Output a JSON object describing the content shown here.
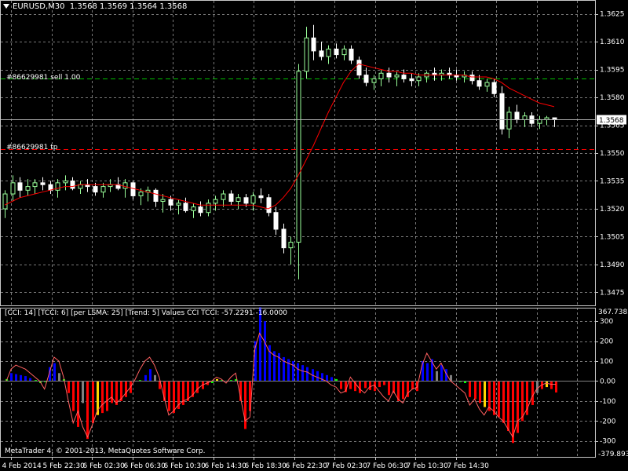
{
  "window": {
    "symbol_label": "EURUSD,M30",
    "ohlc_label": "1.3568 1.3569 1.3564 1.3568",
    "copyright": "MetaTrader 4, © 2001-2013, MetaQuotes Software Corp."
  },
  "orders": {
    "sell_label": "#86629981 sell 1.00",
    "tp_label": "#86629981 tp"
  },
  "price_axis": {
    "ticks": [
      "1.3625",
      "1.3610",
      "1.3595",
      "1.3580",
      "1.3565",
      "1.3550",
      "1.3535",
      "1.3520",
      "1.3505",
      "1.3490",
      "1.3475"
    ],
    "current_price": "1.3568"
  },
  "indicator": {
    "header": "[CCI: 14] [TCCI: 6] [per LSMA: 25] [Trend: 5] Values CCI TCCI: -57.2291 -16.0000",
    "max_label": "367.7385",
    "min_label": "-379.893",
    "ticks": [
      "300",
      "200",
      "100",
      "0.00",
      "-100",
      "-200",
      "-300"
    ]
  },
  "time_axis": {
    "ticks": [
      "4 Feb 2014",
      "5 Feb 22:30",
      "6 Feb 02:30",
      "6 Feb 06:30",
      "6 Feb 10:30",
      "6 Feb 14:30",
      "6 Feb 18:30",
      "6 Feb 22:30",
      "7 Feb 02:30",
      "7 Feb 06:30",
      "7 Feb 10:30",
      "7 Feb 14:30"
    ]
  },
  "colors": {
    "background": "#000000",
    "grid": "#c8c8c8",
    "bull_candle": "#9aff9a",
    "bear_candle": "#ffffff",
    "ma_line": "#ff0000",
    "sell_line": "#00c000",
    "tp_line": "#ff0000",
    "cci_up": "#0000ff",
    "cci_down": "#ff0000",
    "cci_neutral": "#808080",
    "cci_flat": "#00ff00",
    "cci_cross": "#ffd700"
  },
  "chart_data": {
    "type": "candlestick",
    "symbol": "EURUSD",
    "timeframe": "M30",
    "ylim": [
      1.3468,
      1.3632
    ],
    "sell_order_price": 1.359,
    "tp_price": 1.3552,
    "current_price": 1.3568,
    "candles": [
      [
        1.352,
        1.353,
        1.3515,
        1.3528
      ],
      [
        1.3528,
        1.3538,
        1.3524,
        1.3534
      ],
      [
        1.3534,
        1.3537,
        1.3526,
        1.353
      ],
      [
        1.353,
        1.3536,
        1.3527,
        1.3532
      ],
      [
        1.3532,
        1.3536,
        1.3528,
        1.3534
      ],
      [
        1.3534,
        1.3537,
        1.353,
        1.3533
      ],
      [
        1.3533,
        1.3535,
        1.3528,
        1.353
      ],
      [
        1.353,
        1.3536,
        1.3526,
        1.3534
      ],
      [
        1.3534,
        1.3538,
        1.353,
        1.3535
      ],
      [
        1.3535,
        1.3537,
        1.353,
        1.3531
      ],
      [
        1.3531,
        1.3535,
        1.3528,
        1.3533
      ],
      [
        1.3533,
        1.3536,
        1.3529,
        1.3532
      ],
      [
        1.3532,
        1.3534,
        1.3527,
        1.3529
      ],
      [
        1.3529,
        1.3534,
        1.3526,
        1.3532
      ],
      [
        1.3532,
        1.3536,
        1.3529,
        1.3533
      ],
      [
        1.3533,
        1.3537,
        1.353,
        1.3531
      ],
      [
        1.3531,
        1.3536,
        1.3526,
        1.3534
      ],
      [
        1.3534,
        1.3535,
        1.3525,
        1.3527
      ],
      [
        1.3527,
        1.3531,
        1.3522,
        1.3529
      ],
      [
        1.3529,
        1.3532,
        1.3524,
        1.353
      ],
      [
        1.353,
        1.3531,
        1.3521,
        1.3524
      ],
      [
        1.3524,
        1.3528,
        1.3518,
        1.3525
      ],
      [
        1.3525,
        1.3527,
        1.3519,
        1.3522
      ],
      [
        1.3522,
        1.3525,
        1.3517,
        1.3523
      ],
      [
        1.3523,
        1.3526,
        1.3518,
        1.3519
      ],
      [
        1.3519,
        1.3523,
        1.3515,
        1.3521
      ],
      [
        1.3521,
        1.3524,
        1.3516,
        1.3518
      ],
      [
        1.3518,
        1.3525,
        1.3516,
        1.3523
      ],
      [
        1.3523,
        1.3527,
        1.3519,
        1.3525
      ],
      [
        1.3525,
        1.353,
        1.3521,
        1.3528
      ],
      [
        1.3528,
        1.353,
        1.3522,
        1.3524
      ],
      [
        1.3524,
        1.3528,
        1.352,
        1.3526
      ],
      [
        1.3526,
        1.3528,
        1.3521,
        1.3523
      ],
      [
        1.3523,
        1.3529,
        1.3519,
        1.3527
      ],
      [
        1.3527,
        1.3531,
        1.3523,
        1.3526
      ],
      [
        1.3526,
        1.3528,
        1.3516,
        1.3518
      ],
      [
        1.3518,
        1.3521,
        1.3506,
        1.3509
      ],
      [
        1.3509,
        1.3512,
        1.3496,
        1.3499
      ],
      [
        1.3499,
        1.3505,
        1.349,
        1.3502
      ],
      [
        1.3502,
        1.3598,
        1.3482,
        1.3594
      ],
      [
        1.3594,
        1.3618,
        1.359,
        1.3612
      ],
      [
        1.3612,
        1.3619,
        1.36,
        1.3605
      ],
      [
        1.3605,
        1.361,
        1.36,
        1.3602
      ],
      [
        1.3602,
        1.3608,
        1.3598,
        1.3606
      ],
      [
        1.3606,
        1.3609,
        1.3601,
        1.3603
      ],
      [
        1.3603,
        1.3608,
        1.36,
        1.3606
      ],
      [
        1.3606,
        1.3608,
        1.3598,
        1.36
      ],
      [
        1.36,
        1.3602,
        1.359,
        1.3592
      ],
      [
        1.3592,
        1.3596,
        1.3586,
        1.3588
      ],
      [
        1.3588,
        1.3592,
        1.3584,
        1.359
      ],
      [
        1.359,
        1.3595,
        1.3586,
        1.3593
      ],
      [
        1.3593,
        1.3596,
        1.3588,
        1.3591
      ],
      [
        1.3591,
        1.3594,
        1.3586,
        1.3592
      ],
      [
        1.3592,
        1.3595,
        1.3588,
        1.359
      ],
      [
        1.359,
        1.3593,
        1.3586,
        1.3589
      ],
      [
        1.3589,
        1.3593,
        1.3586,
        1.3591
      ],
      [
        1.3591,
        1.3594,
        1.3588,
        1.3593
      ],
      [
        1.3593,
        1.3596,
        1.3589,
        1.3592
      ],
      [
        1.3592,
        1.3595,
        1.3589,
        1.3593
      ],
      [
        1.3593,
        1.3596,
        1.359,
        1.3592
      ],
      [
        1.3592,
        1.3595,
        1.3589,
        1.3591
      ],
      [
        1.3591,
        1.3594,
        1.3588,
        1.3592
      ],
      [
        1.3592,
        1.3594,
        1.3587,
        1.3589
      ],
      [
        1.3589,
        1.3592,
        1.3584,
        1.3586
      ],
      [
        1.3586,
        1.359,
        1.3583,
        1.3588
      ],
      [
        1.3588,
        1.359,
        1.358,
        1.3582
      ],
      [
        1.3582,
        1.3586,
        1.356,
        1.3563
      ],
      [
        1.3563,
        1.3575,
        1.3558,
        1.3572
      ],
      [
        1.3572,
        1.3576,
        1.3566,
        1.3568
      ],
      [
        1.3568,
        1.3572,
        1.3564,
        1.357
      ],
      [
        1.357,
        1.3572,
        1.3564,
        1.3566
      ],
      [
        1.3566,
        1.357,
        1.3563,
        1.3568
      ],
      [
        1.3568,
        1.357,
        1.3565,
        1.3569
      ],
      [
        1.3569,
        1.3569,
        1.3564,
        1.3568
      ]
    ],
    "ma": [
      1.3522,
      1.3524,
      1.3526,
      1.3527,
      1.3528,
      1.3529,
      1.353,
      1.3531,
      1.3532,
      1.3532,
      1.3533,
      1.3533,
      1.3533,
      1.3533,
      1.3533,
      1.3533,
      1.3532,
      1.3531,
      1.353,
      1.3529,
      1.3528,
      1.3527,
      1.3526,
      1.3525,
      1.3524,
      1.3523,
      1.3522,
      1.3522,
      1.3522,
      1.3522,
      1.3522,
      1.3522,
      1.3522,
      1.3522,
      1.3521,
      1.352,
      1.3522,
      1.3526,
      1.3531,
      1.3538,
      1.3546,
      1.3554,
      1.3563,
      1.3572,
      1.358,
      1.3588,
      1.3594,
      1.3598,
      1.3597,
      1.3596,
      1.3595,
      1.3594,
      1.3594,
      1.3593,
      1.3593,
      1.3592,
      1.3592,
      1.3592,
      1.3592,
      1.3592,
      1.3592,
      1.3592,
      1.3591,
      1.3591,
      1.3591,
      1.359,
      1.3588,
      1.3585,
      1.3583,
      1.3581,
      1.3579,
      1.3577,
      1.3576,
      1.3575
    ],
    "cci_hist": [
      10,
      40,
      35,
      30,
      25,
      15,
      5,
      -10,
      -5,
      70,
      90,
      40,
      10,
      -60,
      -150,
      -230,
      -110,
      -290,
      -210,
      -170,
      -160,
      -150,
      -110,
      -120,
      -100,
      -80,
      -60,
      0,
      5,
      30,
      60,
      30,
      -40,
      -100,
      -150,
      -160,
      -140,
      -120,
      -100,
      -80,
      -60,
      -40,
      -20,
      -10,
      10,
      5,
      0,
      5,
      10,
      -100,
      -240,
      -150,
      200,
      370,
      300,
      180,
      150,
      140,
      120,
      110,
      100,
      90,
      80,
      70,
      60,
      50,
      40,
      30,
      20,
      10,
      -40,
      -55,
      -40,
      -50,
      -60,
      -35,
      -45,
      -50,
      -30,
      -20,
      -70,
      -60,
      -100,
      -90,
      -80,
      -40,
      -50,
      100,
      90,
      110,
      50,
      80,
      60,
      30,
      0,
      -5,
      -10,
      -80,
      -90,
      -110,
      -130,
      -150,
      -170,
      -180,
      -210,
      -250,
      -310,
      -260,
      -200,
      -170,
      -120,
      -60,
      -40,
      -30,
      -40,
      -57
    ],
    "tcci": [
      0,
      60,
      80,
      70,
      60,
      40,
      20,
      0,
      -40,
      40,
      120,
      100,
      20,
      -100,
      -210,
      -150,
      -230,
      -280,
      -220,
      -150,
      -120,
      -100,
      -80,
      -110,
      -90,
      -60,
      -30,
      10,
      60,
      100,
      120,
      80,
      20,
      -80,
      -170,
      -150,
      -120,
      -100,
      -90,
      -70,
      -40,
      -20,
      -10,
      0,
      20,
      10,
      -10,
      20,
      40,
      -80,
      -200,
      -180,
      160,
      240,
      200,
      150,
      130,
      120,
      100,
      90,
      80,
      60,
      50,
      45,
      30,
      20,
      10,
      0,
      -20,
      -30,
      -60,
      -50,
      20,
      -10,
      -40,
      -60,
      -30,
      -20,
      -50,
      -80,
      -100,
      -50,
      -90,
      -110,
      -60,
      -40,
      -30,
      80,
      140,
      100,
      60,
      90,
      40,
      0,
      -20,
      -40,
      -60,
      -120,
      -90,
      -140,
      -170,
      -130,
      -150,
      -180,
      -200,
      -240,
      -280,
      -200,
      -180,
      -140,
      -80,
      -40,
      -20,
      -10,
      -16,
      -16
    ]
  }
}
